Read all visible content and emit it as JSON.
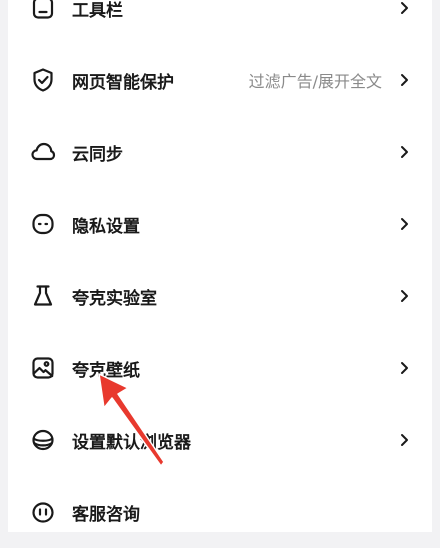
{
  "menu": {
    "items": [
      {
        "label": "工具栏",
        "icon": "toolbar-icon"
      },
      {
        "label": "网页智能保护",
        "icon": "shield-check-icon",
        "value": "过滤广告/展开全文"
      },
      {
        "label": "云同步",
        "icon": "cloud-icon"
      },
      {
        "label": "隐私设置",
        "icon": "privacy-mask-icon"
      },
      {
        "label": "夸克实验室",
        "icon": "flask-icon"
      },
      {
        "label": "夸克壁纸",
        "icon": "wallpaper-icon"
      },
      {
        "label": "设置默认浏览器",
        "icon": "browser-icon"
      },
      {
        "label": "客服咨询",
        "icon": "customer-service-icon"
      }
    ]
  },
  "colors": {
    "background": "#f2f2f4",
    "panel": "#ffffff",
    "text": "#1a1a1a",
    "secondary_text": "#8a8a8a",
    "annotation_arrow": "#e8392e"
  }
}
